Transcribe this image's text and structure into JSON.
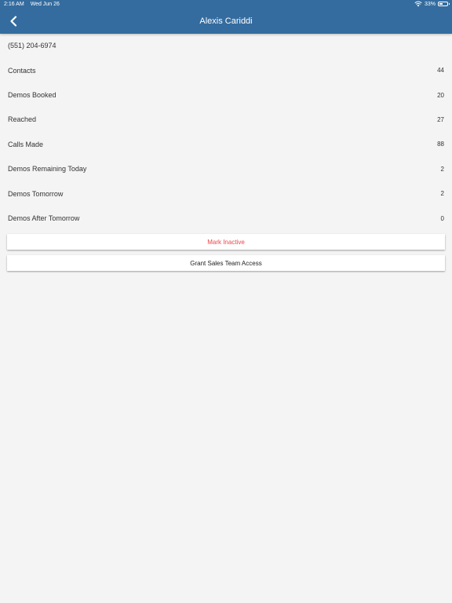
{
  "status_bar": {
    "time": "2:16 AM",
    "date": "Wed Jun 26",
    "battery_percent_label": "33%",
    "battery_level": 0.33,
    "wifi_icon": "wifi-icon",
    "battery_icon": "battery-icon"
  },
  "nav": {
    "title": "Alexis Cariddi",
    "back_icon": "chevron-left-icon"
  },
  "contact": {
    "phone": "(551) 204-6974"
  },
  "stats": [
    {
      "label": "Contacts",
      "value": "44"
    },
    {
      "label": "Demos Booked",
      "value": "20"
    },
    {
      "label": "Reached",
      "value": "27"
    },
    {
      "label": "Calls Made",
      "value": "88"
    },
    {
      "label": "Demos Remaining Today",
      "value": "2"
    },
    {
      "label": "Demos Tomorrow",
      "value": "2"
    },
    {
      "label": "Demos After Tomorrow",
      "value": "0"
    }
  ],
  "actions": {
    "mark_inactive": "Mark Inactive",
    "grant_access": "Grant Sales Team Access"
  },
  "colors": {
    "header": "#346c9f",
    "background": "#f4f4f4",
    "danger_text": "#e8474a"
  }
}
